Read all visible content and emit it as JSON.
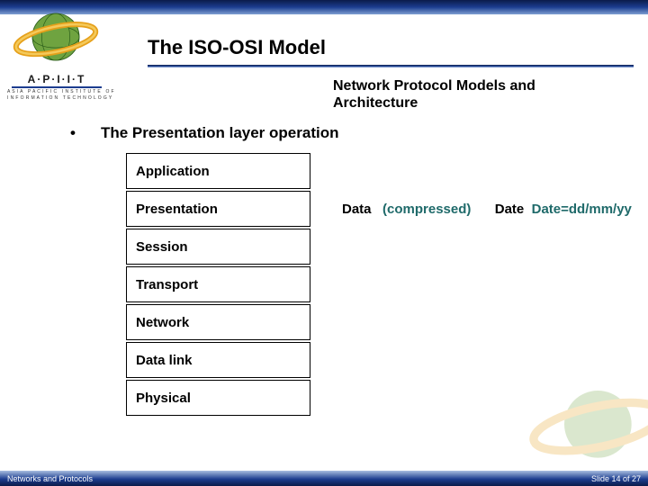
{
  "title": "The ISO-OSI Model",
  "subtitle": "Network Protocol Models and Architecture",
  "org": {
    "letters": "A·P·I·I·T",
    "line1": "A S I A   P A C I F I C   I N S T I T U T E   O F",
    "line2": "I N F O R M A T I O N   T E C H N O L O G Y"
  },
  "bullet": "The Presentation layer operation",
  "layers": [
    "Application",
    "Presentation",
    "Session",
    "Transport",
    "Network",
    "Data link",
    "Physical"
  ],
  "annotation": {
    "data_label": "Data",
    "compressed": "(compressed)",
    "date_label": "Date",
    "date_value": "Date=dd/mm/yy"
  },
  "footer": {
    "left": "Networks and Protocols",
    "right": "Slide 14 of 27"
  }
}
